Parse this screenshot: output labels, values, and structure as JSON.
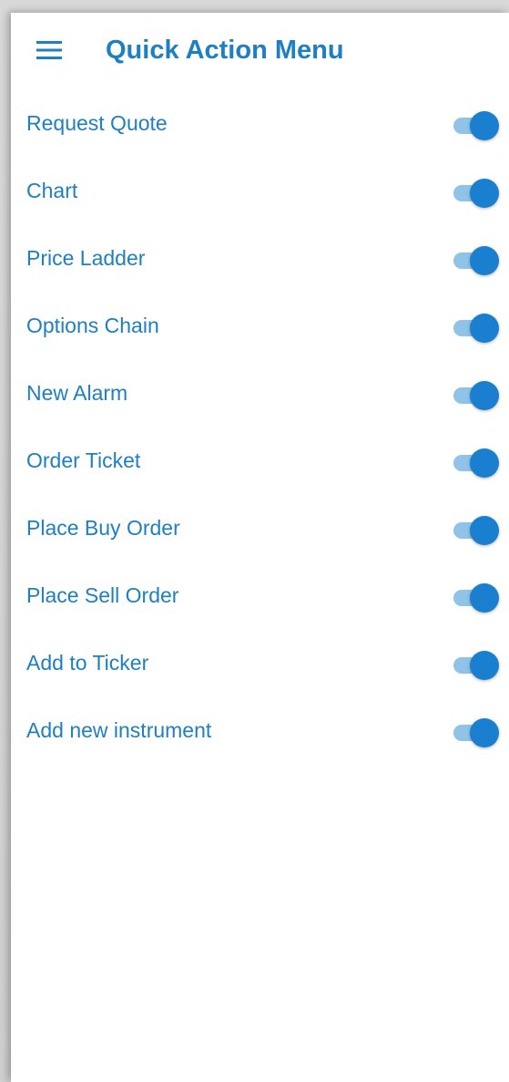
{
  "header": {
    "menu_icon": "hamburger-menu-icon",
    "title": "Quick Action Menu"
  },
  "colors": {
    "accent": "#1e7fc1",
    "toggle_thumb": "#1a7fcf",
    "toggle_track": "#8fc3e8"
  },
  "items": [
    {
      "label": "Request Quote",
      "enabled": true
    },
    {
      "label": "Chart",
      "enabled": true
    },
    {
      "label": "Price Ladder",
      "enabled": true
    },
    {
      "label": "Options Chain",
      "enabled": true
    },
    {
      "label": "New Alarm",
      "enabled": true
    },
    {
      "label": "Order Ticket",
      "enabled": true
    },
    {
      "label": "Place Buy Order",
      "enabled": true
    },
    {
      "label": "Place Sell Order",
      "enabled": true
    },
    {
      "label": "Add to Ticker",
      "enabled": true
    },
    {
      "label": "Add new instrument",
      "enabled": true
    }
  ]
}
